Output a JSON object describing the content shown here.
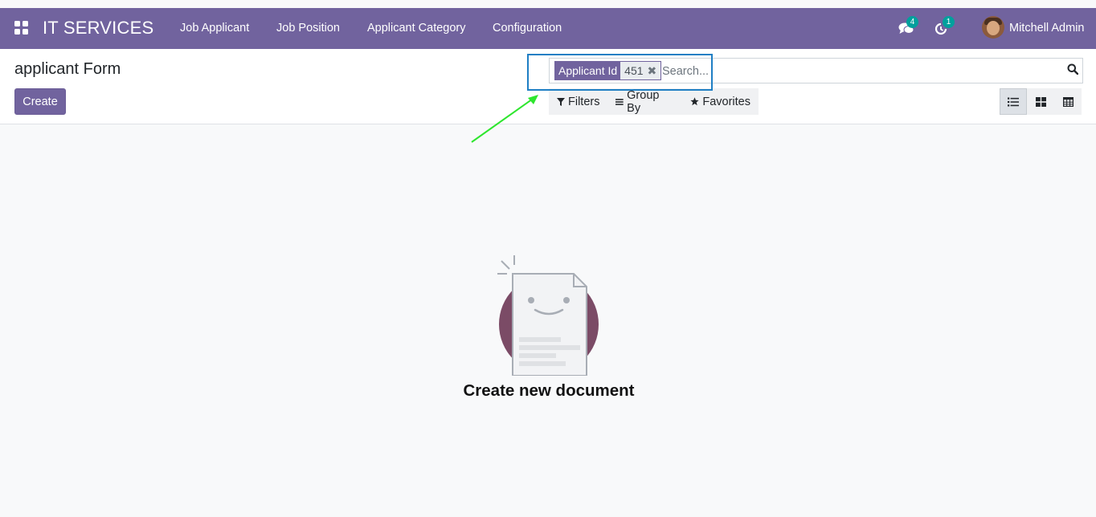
{
  "app": {
    "brand": "IT SERVICES"
  },
  "menu": [
    {
      "label": "Job Applicant"
    },
    {
      "label": "Job Position"
    },
    {
      "label": "Applicant Category"
    },
    {
      "label": "Configuration"
    }
  ],
  "systray": {
    "messages_count": "4",
    "activities_count": "1",
    "user_name": "Mitchell Admin"
  },
  "control_panel": {
    "title": "applicant Form",
    "create_label": "Create"
  },
  "search": {
    "facet_label": "Applicant Id",
    "facet_value": "451",
    "placeholder": "Search..."
  },
  "filters": {
    "filters_label": "Filters",
    "groupby_label": "Group By",
    "favorites_label": "Favorites"
  },
  "views": [
    {
      "name": "list",
      "active": true
    },
    {
      "name": "kanban",
      "active": false
    },
    {
      "name": "pivot",
      "active": false
    }
  ],
  "empty_state": {
    "title": "Create new document"
  },
  "colors": {
    "brand": "#71639e",
    "badge": "#00a09d",
    "highlight_border": "#1f7fc4",
    "arrow": "#2ee62e"
  }
}
